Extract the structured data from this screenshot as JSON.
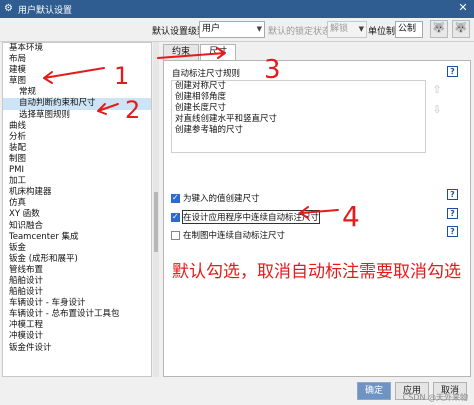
{
  "window": {
    "title": "用户默认设置",
    "close": "✕"
  },
  "topbar": {
    "level_label": "默认设置级别",
    "level_value": "用户",
    "lock_label": "默认的锁定状态",
    "lock_value": "解锁",
    "unit_label": "单位制",
    "unit_value": "公制"
  },
  "sidebar": {
    "items": [
      {
        "label": "基本环境"
      },
      {
        "label": "布局"
      },
      {
        "label": "建模"
      },
      {
        "label": "草图"
      },
      {
        "label": "常规",
        "sub": true
      },
      {
        "label": "自动判断约束和尺寸",
        "sub": true,
        "selected": true
      },
      {
        "label": "选择草图规则",
        "sub": true
      },
      {
        "label": "曲线"
      },
      {
        "label": "分析"
      },
      {
        "label": "装配"
      },
      {
        "label": "制图"
      },
      {
        "label": "PMI"
      },
      {
        "label": "加工"
      },
      {
        "label": "机床构建器"
      },
      {
        "label": "仿真"
      },
      {
        "label": "XY 函数"
      },
      {
        "label": "知识融合"
      },
      {
        "label": "Teamcenter 集成"
      },
      {
        "label": "钣金"
      },
      {
        "label": "钣金 (成形和展平)"
      },
      {
        "label": "管线布置"
      },
      {
        "label": "船舶设计"
      },
      {
        "label": "船舶设计"
      },
      {
        "label": "车辆设计 - 车身设计"
      },
      {
        "label": "车辆设计 - 总布置设计工具包"
      },
      {
        "label": "冲模工程"
      },
      {
        "label": "冲模设计"
      },
      {
        "label": "钣金件设计"
      }
    ]
  },
  "tabs": [
    {
      "label": "约束",
      "active": false
    },
    {
      "label": "尺寸",
      "active": true
    }
  ],
  "content": {
    "section_title": "自动标注尺寸规则",
    "help": "?",
    "rules": [
      "创建对称尺寸",
      "创建相邻角度",
      "创建长度尺寸",
      "对直线创建水平和竖直尺寸",
      "创建参考轴的尺寸"
    ],
    "options": [
      {
        "label": "为键入的值创建尺寸",
        "checked": true
      },
      {
        "label": "在设计应用程序中连续自动标注尺寸",
        "checked": true
      },
      {
        "label": "在制图中连续自动标注尺寸",
        "checked": false
      }
    ]
  },
  "annotations": {
    "n1": "1",
    "n2": "2",
    "n3": "3",
    "n4": "4",
    "note": "默认勾选，取消自动标注需要取消勾选"
  },
  "buttons": {
    "ok": "确定",
    "apply": "应用",
    "cancel": "取消"
  },
  "watermark": "CSDN @天外来物",
  "colors": {
    "title_bar": "#2f5d91",
    "selection": "#cde4f7",
    "annotation": "#e21b1b",
    "check": "#2d6bd1"
  }
}
